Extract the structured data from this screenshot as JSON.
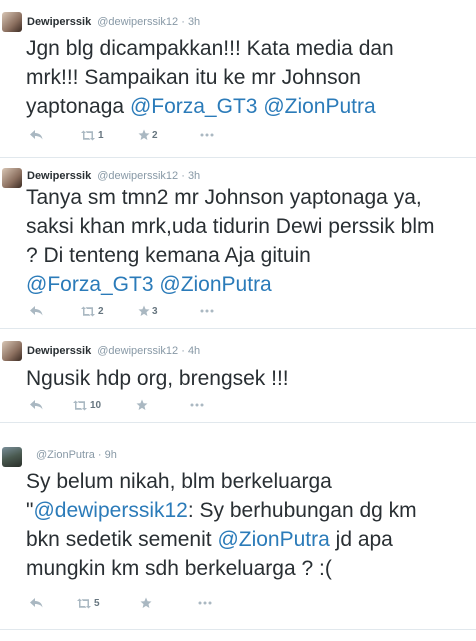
{
  "tweets": [
    {
      "name": "Dewiperssik",
      "handle": "@dewiperssik12",
      "separator": "·",
      "time": "3h",
      "lines": [
        [
          {
            "t": "Jgn blg dicampakkan!!! Kata media dan"
          }
        ],
        [
          {
            "t": "mrk!!! Sampaikan itu ke mr Johnson"
          }
        ],
        [
          {
            "t": "yaptonaga "
          },
          {
            "t": "@Forza_GT3",
            "m": true
          },
          {
            "t": " "
          },
          {
            "t": "@ZionPutra",
            "m": true
          }
        ]
      ],
      "retweets": "1",
      "favorites": "2"
    },
    {
      "name": "Dewiperssik",
      "handle": "@dewiperssik12",
      "separator": "·",
      "time": "3h",
      "lines": [
        [
          {
            "t": "Tanya sm tmn2 mr Johnson yaptonaga ya,"
          }
        ],
        [
          {
            "t": "saksi khan mrk,uda tidurin Dewi perssik blm"
          }
        ],
        [
          {
            "t": "? Di tenteng kemana Aja gituin"
          }
        ],
        [
          {
            "t": "@Forza_GT3",
            "m": true
          },
          {
            "t": " "
          },
          {
            "t": "@ZionPutra",
            "m": true
          }
        ]
      ],
      "retweets": "2",
      "favorites": "3"
    },
    {
      "name": "Dewiperssik",
      "handle": "@dewiperssik12",
      "separator": "·",
      "time": "4h",
      "lines": [
        [
          {
            "t": "Ngusik hdp org, brengsek !!!"
          }
        ]
      ],
      "retweets": "10",
      "favorites": ""
    },
    {
      "name": "",
      "handle": "@ZionPutra",
      "separator": "·",
      "time": "9h",
      "lines": [
        [
          {
            "t": "Sy belum nikah, blm berkeluarga"
          }
        ],
        [
          {
            "t": "\""
          },
          {
            "t": "@dewiperssik12",
            "m": true
          },
          {
            "t": ": Sy berhubungan dg km"
          }
        ],
        [
          {
            "t": "bkn sedetik semenit "
          },
          {
            "t": "@ZionPutra",
            "m": true
          },
          {
            "t": "  jd apa"
          }
        ],
        [
          {
            "t": "mungkin km sdh berkeluarga ? :("
          }
        ]
      ],
      "retweets": "5",
      "favorites": ""
    }
  ],
  "icons": {
    "reply": "reply-icon",
    "retweet": "retweet-icon",
    "favorite": "favorite-star-icon",
    "more": "more-dots-icon"
  },
  "colors": {
    "mention": "#2b7bb9",
    "meta": "#8899a6",
    "text": "#292f33",
    "icon": "#aab8c2"
  }
}
